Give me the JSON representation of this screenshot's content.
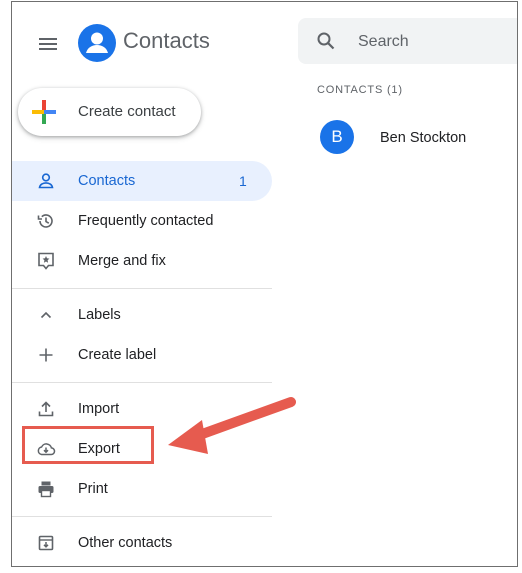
{
  "app": {
    "title": "Contacts",
    "brand_color": "#1a73e8"
  },
  "actions": {
    "create_contact_label": "Create contact"
  },
  "nav": {
    "contacts": {
      "label": "Contacts",
      "count": "1",
      "icon": "person-icon"
    },
    "frequently_contacted": {
      "label": "Frequently contacted",
      "icon": "history-icon"
    },
    "merge_and_fix": {
      "label": "Merge and fix",
      "icon": "merge-icon"
    }
  },
  "labels_section": {
    "header": "Labels",
    "create_label": "Create label"
  },
  "tools": {
    "import": "Import",
    "export": "Export",
    "print": "Print"
  },
  "other_contacts": "Other contacts",
  "search": {
    "placeholder": "Search"
  },
  "contact_list": {
    "header": "CONTACTS (1)",
    "items": [
      {
        "initial": "B",
        "name": "Ben Stockton",
        "avatar_color": "#1a73e8"
      }
    ]
  },
  "annotation": {
    "highlight_color": "#e65b4f",
    "target": "Export"
  }
}
